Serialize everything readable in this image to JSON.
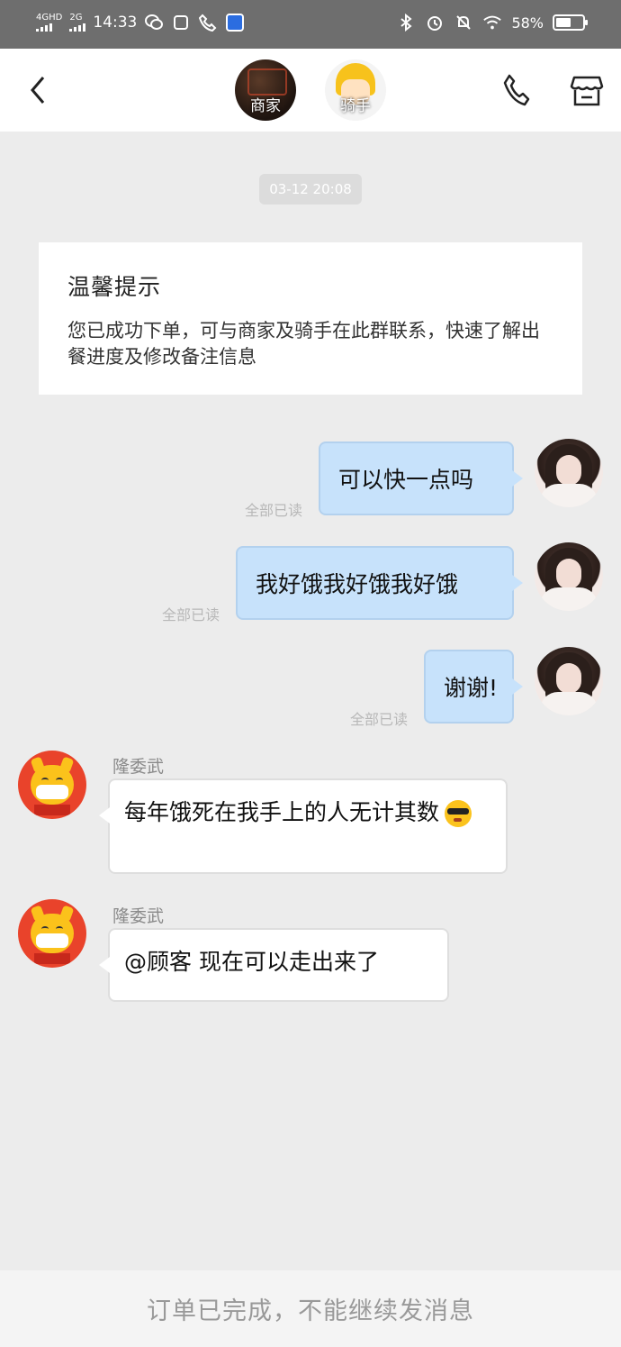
{
  "status_bar": {
    "network1": "4GHD",
    "network2": "2G",
    "time": "14:33",
    "battery": "58%",
    "battery_level": 0.58
  },
  "header": {
    "merchant_label": "商家",
    "rider_label": "骑手"
  },
  "chat": {
    "timestamp": "03-12 20:08",
    "tip": {
      "title": "温馨提示",
      "body": "您已成功下单，可与商家及骑手在此群联系，快速了解出餐进度及修改备注信息"
    },
    "my_messages": [
      {
        "text": "可以快一点吗",
        "status": "全部已读"
      },
      {
        "text": "我好饿我好饿我好饿",
        "status": "全部已读"
      },
      {
        "text": "谢谢!",
        "status": "全部已读"
      }
    ],
    "rider_messages": [
      {
        "sender": "隆委武",
        "text": "每年饿死在我手上的人无计其数",
        "emoji": "sunglasses-emoji"
      },
      {
        "sender": "隆委武",
        "text": "@顾客 现在可以走出来了"
      }
    ]
  },
  "footer": {
    "notice": "订单已完成，不能继续发消息"
  },
  "colors": {
    "my_bubble": "#c7e2fb",
    "rider_avatar_bg": "#e9432b",
    "status_bar_bg": "#6e6e6e"
  }
}
